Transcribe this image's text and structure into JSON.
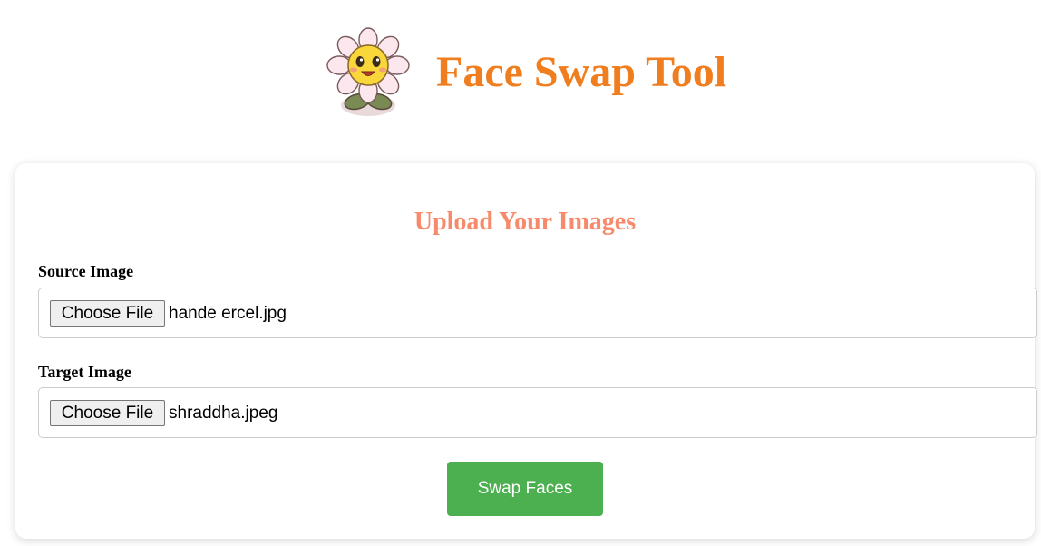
{
  "header": {
    "title": "Face Swap Tool",
    "logo_icon": "flower-mascot-icon",
    "title_color": "#f07d1e"
  },
  "upload_card": {
    "title": "Upload Your Images",
    "title_color": "#f88a6b",
    "source": {
      "label": "Source Image",
      "button_label": "Choose File",
      "file_name": "hande ercel.jpg"
    },
    "target": {
      "label": "Target Image",
      "button_label": "Choose File",
      "file_name": "shraddha.jpeg"
    },
    "submit": {
      "label": "Swap Faces",
      "color": "#4caf50"
    }
  }
}
